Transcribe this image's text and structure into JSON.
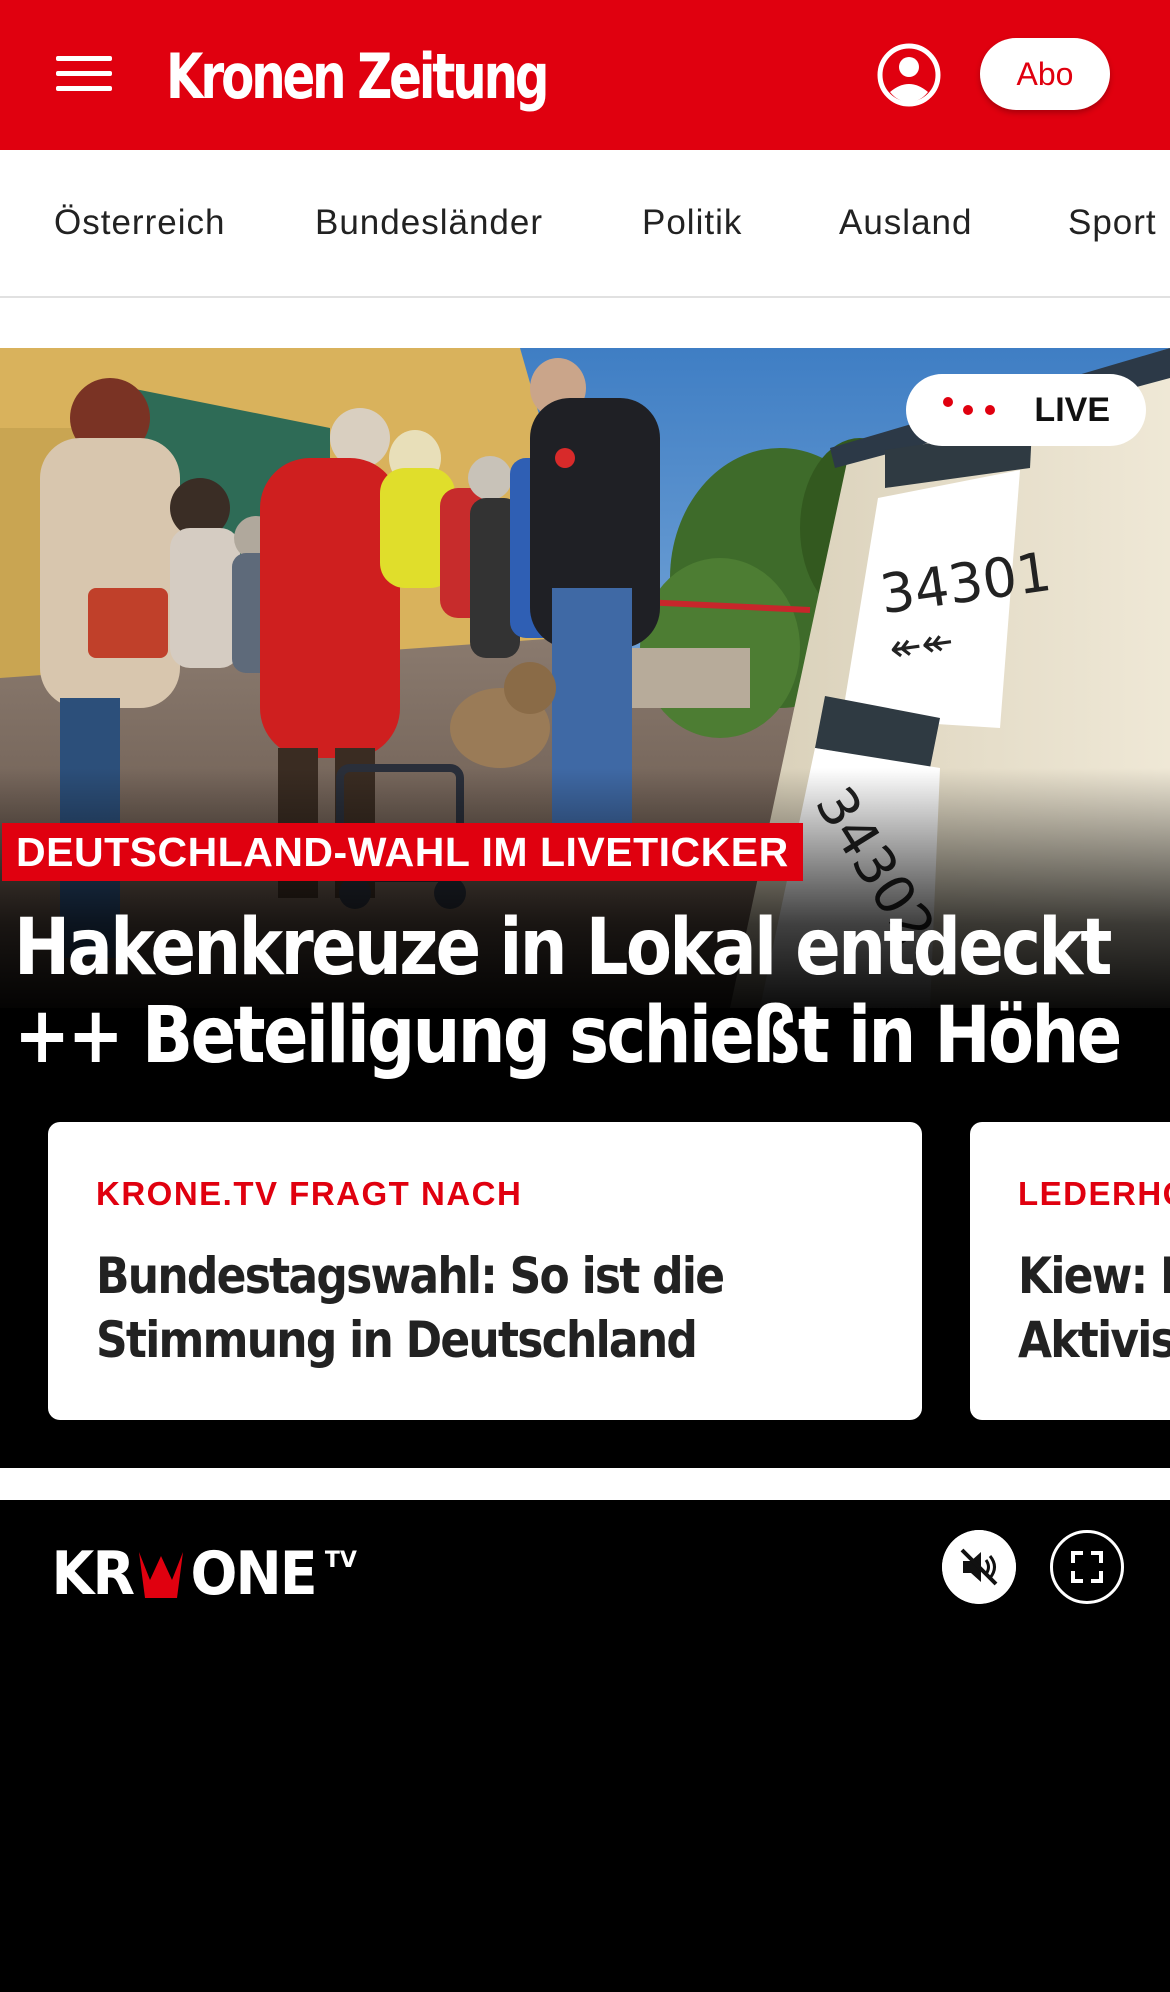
{
  "header": {
    "brand": "Kronen Zeitung",
    "menu_icon": "hamburger-menu-icon",
    "user_icon": "user-account-icon",
    "abo_label": "Abo"
  },
  "nav": {
    "items": [
      {
        "label": "Österreich"
      },
      {
        "label": "Bundesländer"
      },
      {
        "label": "Politik"
      },
      {
        "label": "Ausland"
      },
      {
        "label": "Sport"
      }
    ]
  },
  "hero": {
    "live_label": "LIVE",
    "kicker": "DEUTSCHLAND-WAHL IM LIVETICKER",
    "headline_line1": "Hakenkreuze in Lokal entdeckt",
    "headline_line2": "++ Beteiligung schießt in Höhe",
    "image_sign_top": "34301",
    "image_sign_bottom": "34302"
  },
  "cards": [
    {
      "kicker": "KRONE.TV FRAGT NACH",
      "title_line1": "Bundestagswahl: So ist die",
      "title_line2": "Stimmung in Deutschland"
    },
    {
      "kicker": "LEDERHO",
      "title_line1": "Kiew: I",
      "title_line2": "Aktivis"
    }
  ],
  "tv": {
    "logo_left": "KR",
    "logo_right": "ONE",
    "logo_sup": "TV",
    "mute_icon": "mute-icon",
    "fullscreen_icon": "fullscreen-icon"
  },
  "colors": {
    "brand_red": "#e0000f",
    "black": "#000000",
    "white": "#ffffff"
  }
}
